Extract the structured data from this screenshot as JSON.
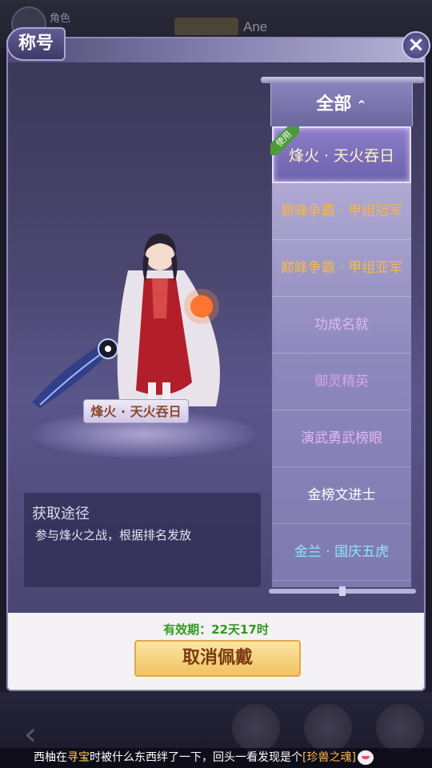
{
  "background": {
    "role_label": "角色",
    "name": "Ane"
  },
  "panel": {
    "title": "称号",
    "close_icon": "close-icon"
  },
  "character": {
    "equipped_title": "烽火 · 天火吞日"
  },
  "acquire": {
    "heading": "获取途径",
    "description": "参与烽火之战，根据排名发放"
  },
  "filter": {
    "label": "全部",
    "arrow": "⌃"
  },
  "titles": [
    {
      "label": "烽火 · 天火吞日",
      "selected": true,
      "badge": "使用",
      "color": "#fff3c8"
    },
    {
      "label": "巅峰争霸 · 甲组冠军",
      "selected": false,
      "color": "#f6b44a"
    },
    {
      "label": "巅峰争霸 · 甲组亚军",
      "selected": false,
      "color": "#f2b94e"
    },
    {
      "label": "功成名就",
      "selected": false,
      "color": "#e3b8f2"
    },
    {
      "label": "御灵精英",
      "selected": false,
      "color": "#d6a2f2"
    },
    {
      "label": "演武勇武榜眼",
      "selected": false,
      "color": "#e6b6f4"
    },
    {
      "label": "金榜文进士",
      "selected": false,
      "color": "#ffffff"
    },
    {
      "label": "金兰 · 国庆五虎",
      "selected": false,
      "color": "#8fe4ff"
    }
  ],
  "footer": {
    "validity": "有效期：22天17时",
    "cancel_button": "取消佩戴"
  },
  "ticker": {
    "part1": "西柚在",
    "highlight1": "寻宝",
    "part2": "时被什么东西绊了一下，回头一看发现是个",
    "highlight2": "[珍兽之魂]"
  }
}
